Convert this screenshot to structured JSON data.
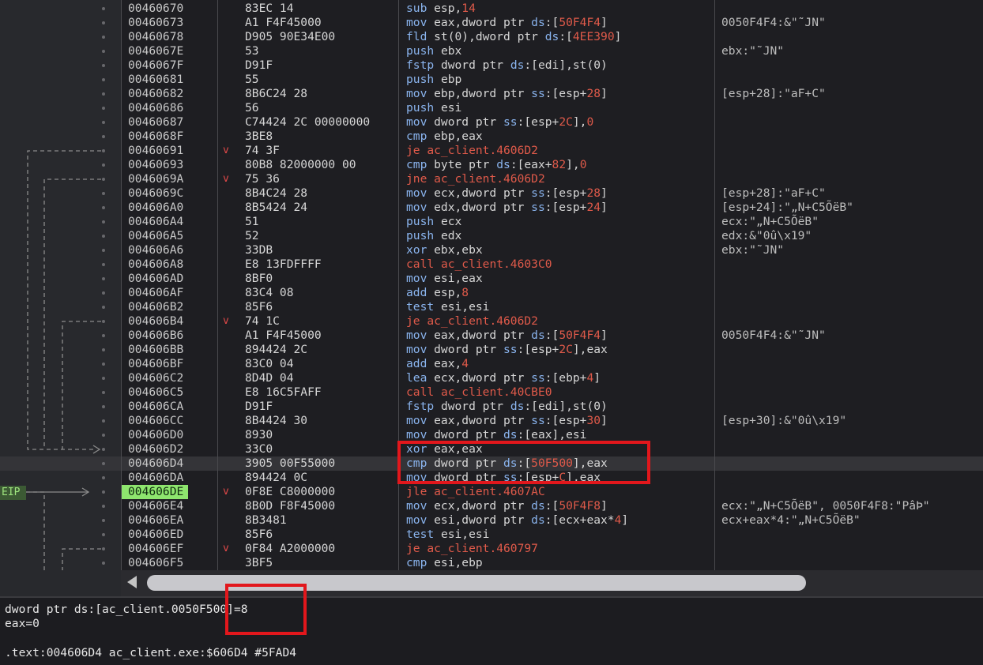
{
  "eip_label": "EIP",
  "rows": [
    {
      "addr": "00460670",
      "arrow": "",
      "bytes": "83EC 14",
      "mn": "sub",
      "mn_type": "",
      "ops": [
        {
          "t": " esp,",
          "c": "op"
        },
        {
          "t": "14",
          "c": "num"
        }
      ],
      "cmt": ""
    },
    {
      "addr": "00460673",
      "arrow": "",
      "bytes": "A1 F4F45000",
      "mn": "mov",
      "mn_type": "",
      "ops": [
        {
          "t": " eax,dword ptr ",
          "c": "op"
        },
        {
          "t": "ds",
          "c": "seg"
        },
        {
          "t": ":[",
          "c": "op"
        },
        {
          "t": "50F4F4",
          "c": "num"
        },
        {
          "t": "]",
          "c": "op"
        }
      ],
      "cmt": "0050F4F4:&\"˜JN\""
    },
    {
      "addr": "00460678",
      "arrow": "",
      "bytes": "D905 90E34E00",
      "mn": "fld",
      "mn_type": "",
      "ops": [
        {
          "t": " st(0),dword ptr ",
          "c": "op"
        },
        {
          "t": "ds",
          "c": "seg"
        },
        {
          "t": ":[",
          "c": "op"
        },
        {
          "t": "4EE390",
          "c": "num"
        },
        {
          "t": "]",
          "c": "op"
        }
      ],
      "cmt": ""
    },
    {
      "addr": "0046067E",
      "arrow": "",
      "bytes": "53",
      "mn": "push",
      "mn_type": "",
      "ops": [
        {
          "t": " ebx",
          "c": "op"
        }
      ],
      "cmt": "ebx:\"˜JN\""
    },
    {
      "addr": "0046067F",
      "arrow": "",
      "bytes": "D91F",
      "mn": "fstp",
      "mn_type": "",
      "ops": [
        {
          "t": " dword ptr ",
          "c": "op"
        },
        {
          "t": "ds",
          "c": "seg"
        },
        {
          "t": ":[edi],st(0)",
          "c": "op"
        }
      ],
      "cmt": ""
    },
    {
      "addr": "00460681",
      "arrow": "",
      "bytes": "55",
      "mn": "push",
      "mn_type": "",
      "ops": [
        {
          "t": " ebp",
          "c": "op"
        }
      ],
      "cmt": ""
    },
    {
      "addr": "00460682",
      "arrow": "",
      "bytes": "8B6C24 28",
      "mn": "mov",
      "mn_type": "",
      "ops": [
        {
          "t": " ebp,dword ptr ",
          "c": "op"
        },
        {
          "t": "ss",
          "c": "seg"
        },
        {
          "t": ":[esp+",
          "c": "op"
        },
        {
          "t": "28",
          "c": "num"
        },
        {
          "t": "]",
          "c": "op"
        }
      ],
      "cmt": "[esp+28]:\"aF+C\""
    },
    {
      "addr": "00460686",
      "arrow": "",
      "bytes": "56",
      "mn": "push",
      "mn_type": "",
      "ops": [
        {
          "t": " esi",
          "c": "op"
        }
      ],
      "cmt": ""
    },
    {
      "addr": "00460687",
      "arrow": "",
      "bytes": "C74424 2C 00000000",
      "mn": "mov",
      "mn_type": "",
      "ops": [
        {
          "t": " dword ptr ",
          "c": "op"
        },
        {
          "t": "ss",
          "c": "seg"
        },
        {
          "t": ":[esp+",
          "c": "op"
        },
        {
          "t": "2C",
          "c": "num"
        },
        {
          "t": "],",
          "c": "op"
        },
        {
          "t": "0",
          "c": "num"
        }
      ],
      "cmt": ""
    },
    {
      "addr": "0046068F",
      "arrow": "",
      "bytes": "3BE8",
      "mn": "cmp",
      "mn_type": "",
      "ops": [
        {
          "t": " ebp,eax",
          "c": "op"
        }
      ],
      "cmt": ""
    },
    {
      "addr": "00460691",
      "arrow": "v",
      "bytes": "74 3F",
      "mn": "je",
      "mn_type": "jmp",
      "ops": [
        {
          "t": " ac_client.4606D2",
          "c": "num"
        }
      ],
      "cmt": ""
    },
    {
      "addr": "00460693",
      "arrow": "",
      "bytes": "80B8 82000000 00",
      "mn": "cmp",
      "mn_type": "",
      "ops": [
        {
          "t": " byte ptr ",
          "c": "op"
        },
        {
          "t": "ds",
          "c": "seg"
        },
        {
          "t": ":[eax+",
          "c": "op"
        },
        {
          "t": "82",
          "c": "num"
        },
        {
          "t": "],",
          "c": "op"
        },
        {
          "t": "0",
          "c": "num"
        }
      ],
      "cmt": ""
    },
    {
      "addr": "0046069A",
      "arrow": "v",
      "bytes": "75 36",
      "mn": "jne",
      "mn_type": "jmp",
      "ops": [
        {
          "t": " ac_client.4606D2",
          "c": "num"
        }
      ],
      "cmt": ""
    },
    {
      "addr": "0046069C",
      "arrow": "",
      "bytes": "8B4C24 28",
      "mn": "mov",
      "mn_type": "",
      "ops": [
        {
          "t": " ecx,dword ptr ",
          "c": "op"
        },
        {
          "t": "ss",
          "c": "seg"
        },
        {
          "t": ":[esp+",
          "c": "op"
        },
        {
          "t": "28",
          "c": "num"
        },
        {
          "t": "]",
          "c": "op"
        }
      ],
      "cmt": "[esp+28]:\"aF+C\""
    },
    {
      "addr": "004606A0",
      "arrow": "",
      "bytes": "8B5424 24",
      "mn": "mov",
      "mn_type": "",
      "ops": [
        {
          "t": " edx,dword ptr ",
          "c": "op"
        },
        {
          "t": "ss",
          "c": "seg"
        },
        {
          "t": ":[esp+",
          "c": "op"
        },
        {
          "t": "24",
          "c": "num"
        },
        {
          "t": "]",
          "c": "op"
        }
      ],
      "cmt": "[esp+24]:\"„N+C5ÕëB\""
    },
    {
      "addr": "004606A4",
      "arrow": "",
      "bytes": "51",
      "mn": "push",
      "mn_type": "",
      "ops": [
        {
          "t": " ecx",
          "c": "op"
        }
      ],
      "cmt": "ecx:\"„N+C5ÕëB\""
    },
    {
      "addr": "004606A5",
      "arrow": "",
      "bytes": "52",
      "mn": "push",
      "mn_type": "",
      "ops": [
        {
          "t": " edx",
          "c": "op"
        }
      ],
      "cmt": "edx:&\"0û\\x19\""
    },
    {
      "addr": "004606A6",
      "arrow": "",
      "bytes": "33DB",
      "mn": "xor",
      "mn_type": "",
      "ops": [
        {
          "t": " ebx,ebx",
          "c": "op"
        }
      ],
      "cmt": "ebx:\"˜JN\""
    },
    {
      "addr": "004606A8",
      "arrow": "",
      "bytes": "E8 13FDFFFF",
      "mn": "call",
      "mn_type": "call",
      "ops": [
        {
          "t": " ac_client.4603C0",
          "c": "num"
        }
      ],
      "cmt": ""
    },
    {
      "addr": "004606AD",
      "arrow": "",
      "bytes": "8BF0",
      "mn": "mov",
      "mn_type": "",
      "ops": [
        {
          "t": " esi,eax",
          "c": "op"
        }
      ],
      "cmt": ""
    },
    {
      "addr": "004606AF",
      "arrow": "",
      "bytes": "83C4 08",
      "mn": "add",
      "mn_type": "",
      "ops": [
        {
          "t": " esp,",
          "c": "op"
        },
        {
          "t": "8",
          "c": "num"
        }
      ],
      "cmt": ""
    },
    {
      "addr": "004606B2",
      "arrow": "",
      "bytes": "85F6",
      "mn": "test",
      "mn_type": "",
      "ops": [
        {
          "t": " esi,esi",
          "c": "op"
        }
      ],
      "cmt": ""
    },
    {
      "addr": "004606B4",
      "arrow": "v",
      "bytes": "74 1C",
      "mn": "je",
      "mn_type": "jmp",
      "ops": [
        {
          "t": " ac_client.4606D2",
          "c": "num"
        }
      ],
      "cmt": ""
    },
    {
      "addr": "004606B6",
      "arrow": "",
      "bytes": "A1 F4F45000",
      "mn": "mov",
      "mn_type": "",
      "ops": [
        {
          "t": " eax,dword ptr ",
          "c": "op"
        },
        {
          "t": "ds",
          "c": "seg"
        },
        {
          "t": ":[",
          "c": "op"
        },
        {
          "t": "50F4F4",
          "c": "num"
        },
        {
          "t": "]",
          "c": "op"
        }
      ],
      "cmt": "0050F4F4:&\"˜JN\""
    },
    {
      "addr": "004606BB",
      "arrow": "",
      "bytes": "894424 2C",
      "mn": "mov",
      "mn_type": "",
      "ops": [
        {
          "t": " dword ptr ",
          "c": "op"
        },
        {
          "t": "ss",
          "c": "seg"
        },
        {
          "t": ":[esp+",
          "c": "op"
        },
        {
          "t": "2C",
          "c": "num"
        },
        {
          "t": "],eax",
          "c": "op"
        }
      ],
      "cmt": ""
    },
    {
      "addr": "004606BF",
      "arrow": "",
      "bytes": "83C0 04",
      "mn": "add",
      "mn_type": "",
      "ops": [
        {
          "t": " eax,",
          "c": "op"
        },
        {
          "t": "4",
          "c": "num"
        }
      ],
      "cmt": ""
    },
    {
      "addr": "004606C2",
      "arrow": "",
      "bytes": "8D4D 04",
      "mn": "lea",
      "mn_type": "",
      "ops": [
        {
          "t": " ecx,dword ptr ",
          "c": "op"
        },
        {
          "t": "ss",
          "c": "seg"
        },
        {
          "t": ":[ebp+",
          "c": "op"
        },
        {
          "t": "4",
          "c": "num"
        },
        {
          "t": "]",
          "c": "op"
        }
      ],
      "cmt": ""
    },
    {
      "addr": "004606C5",
      "arrow": "",
      "bytes": "E8 16C5FAFF",
      "mn": "call",
      "mn_type": "call",
      "ops": [
        {
          "t": " ac_client.40CBE0",
          "c": "num"
        }
      ],
      "cmt": ""
    },
    {
      "addr": "004606CA",
      "arrow": "",
      "bytes": "D91F",
      "mn": "fstp",
      "mn_type": "",
      "ops": [
        {
          "t": " dword ptr ",
          "c": "op"
        },
        {
          "t": "ds",
          "c": "seg"
        },
        {
          "t": ":[edi],st(0)",
          "c": "op"
        }
      ],
      "cmt": ""
    },
    {
      "addr": "004606CC",
      "arrow": "",
      "bytes": "8B4424 30",
      "mn": "mov",
      "mn_type": "",
      "ops": [
        {
          "t": " eax,dword ptr ",
          "c": "op"
        },
        {
          "t": "ss",
          "c": "seg"
        },
        {
          "t": ":[esp+",
          "c": "op"
        },
        {
          "t": "30",
          "c": "num"
        },
        {
          "t": "]",
          "c": "op"
        }
      ],
      "cmt": "[esp+30]:&\"0û\\x19\""
    },
    {
      "addr": "004606D0",
      "arrow": "",
      "bytes": "8930",
      "mn": "mov",
      "mn_type": "",
      "ops": [
        {
          "t": " dword ptr ",
          "c": "op"
        },
        {
          "t": "ds",
          "c": "seg"
        },
        {
          "t": ":[eax],esi",
          "c": "op"
        }
      ],
      "cmt": ""
    },
    {
      "addr": "004606D2",
      "arrow": "",
      "bytes": "33C0",
      "mn": "xor",
      "mn_type": "",
      "ops": [
        {
          "t": " eax,eax",
          "c": "op"
        }
      ],
      "cmt": ""
    },
    {
      "addr": "004606D4",
      "arrow": "",
      "bytes": "3905 00F55000",
      "mn": "cmp",
      "mn_type": "",
      "ops": [
        {
          "t": " dword ptr ",
          "c": "op"
        },
        {
          "t": "ds",
          "c": "seg"
        },
        {
          "t": ":[",
          "c": "op"
        },
        {
          "t": "50F500",
          "c": "num"
        },
        {
          "t": "],eax",
          "c": "op"
        }
      ],
      "cmt": "",
      "hl": true
    },
    {
      "addr": "004606DA",
      "arrow": "",
      "bytes": "894424 0C",
      "mn": "mov",
      "mn_type": "",
      "ops": [
        {
          "t": " dword ptr ",
          "c": "op"
        },
        {
          "t": "ss",
          "c": "seg"
        },
        {
          "t": ":[esp+",
          "c": "op"
        },
        {
          "t": "C",
          "c": "num"
        },
        {
          "t": "],eax",
          "c": "op"
        }
      ],
      "cmt": ""
    },
    {
      "addr": "004606DE",
      "arrow": "v",
      "bytes": "0F8E C8000000",
      "mn": "jle",
      "mn_type": "jmp",
      "ops": [
        {
          "t": " ac_client.4607AC",
          "c": "num"
        }
      ],
      "cmt": "",
      "eip": true
    },
    {
      "addr": "004606E4",
      "arrow": "",
      "bytes": "8B0D F8F45000",
      "mn": "mov",
      "mn_type": "",
      "ops": [
        {
          "t": " ecx,dword ptr ",
          "c": "op"
        },
        {
          "t": "ds",
          "c": "seg"
        },
        {
          "t": ":[",
          "c": "op"
        },
        {
          "t": "50F4F8",
          "c": "num"
        },
        {
          "t": "]",
          "c": "op"
        }
      ],
      "cmt": "ecx:\"„N+C5ÕëB\", 0050F4F8:\"PâÞ\""
    },
    {
      "addr": "004606EA",
      "arrow": "",
      "bytes": "8B3481",
      "mn": "mov",
      "mn_type": "",
      "ops": [
        {
          "t": " esi,dword ptr ",
          "c": "op"
        },
        {
          "t": "ds",
          "c": "seg"
        },
        {
          "t": ":[ecx+eax*",
          "c": "op"
        },
        {
          "t": "4",
          "c": "num"
        },
        {
          "t": "]",
          "c": "op"
        }
      ],
      "cmt": "ecx+eax*4:\"„N+C5ÕëB\""
    },
    {
      "addr": "004606ED",
      "arrow": "",
      "bytes": "85F6",
      "mn": "test",
      "mn_type": "",
      "ops": [
        {
          "t": " esi,esi",
          "c": "op"
        }
      ],
      "cmt": ""
    },
    {
      "addr": "004606EF",
      "arrow": "v",
      "bytes": "0F84 A2000000",
      "mn": "je",
      "mn_type": "jmp",
      "ops": [
        {
          "t": " ac_client.460797",
          "c": "num"
        }
      ],
      "cmt": ""
    },
    {
      "addr": "004606F5",
      "arrow": "",
      "bytes": "3BF5",
      "mn": "cmp",
      "mn_type": "",
      "ops": [
        {
          "t": " esi,ebp",
          "c": "op"
        }
      ],
      "cmt": ""
    }
  ],
  "info": {
    "line1": "dword ptr ds:[ac_client.0050F500]=8",
    "line2": "eax=0",
    "line3": ".text:004606D4 ac_client.exe:$606D4 #5FAD4"
  },
  "colors": {
    "mnemonic": "#8ab4ee",
    "jump": "#e05a4a",
    "highlight_box": "#e2171c",
    "eip": "#8ee56e"
  }
}
